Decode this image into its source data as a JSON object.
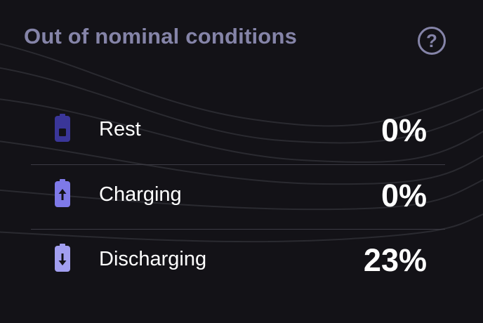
{
  "panel": {
    "title": "Out of nominal conditions",
    "help_symbol": "?",
    "help_icon": "help-circle-icon"
  },
  "colors": {
    "background": "#131217",
    "title": "#8584a8",
    "rest_icon": "#3a3699",
    "charging_icon": "#7e79e8",
    "discharging_icon": "#a29ff0",
    "divider": "#3c3b44",
    "text": "#ffffff"
  },
  "rows": [
    {
      "icon": "battery-rest-icon",
      "label": "Rest",
      "value": "0%"
    },
    {
      "icon": "battery-charging-icon",
      "label": "Charging",
      "value": "0%"
    },
    {
      "icon": "battery-discharging-icon",
      "label": "Discharging",
      "value": "23%"
    }
  ]
}
